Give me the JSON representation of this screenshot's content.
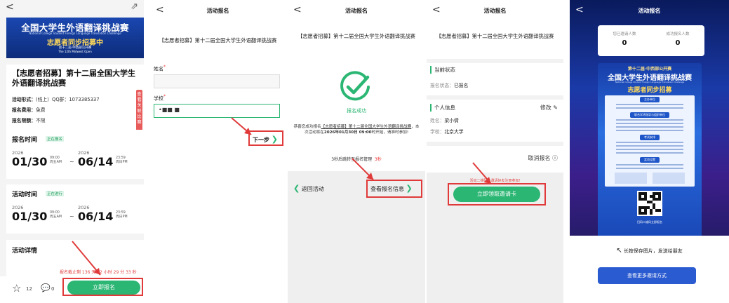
{
  "p1": {
    "back": "<",
    "share": "⇗",
    "banner": {
      "line1": "全国大学生外语翻译挑战赛",
      "line2": "National College Student Foreign Language Translation Challenge",
      "line3": "志愿者同步招募中",
      "line4": "第十二届·中西部公开赛",
      "line5": "The 12th Midwest Open"
    },
    "title": "【志愿者招募】第十二届全国大学生外语翻译挑战赛",
    "rows": [
      {
        "k": "活动形式：",
        "v": "(线上）QQ群：1073385337"
      },
      {
        "k": "报名费用：",
        "v": "免费"
      },
      {
        "k": "报名限额：",
        "v": "不限"
      }
    ],
    "side_tab": "查看关联比赛",
    "reg": {
      "label": "报名时间",
      "tag": "正在报名",
      "start_year": "2026",
      "start_date": "01/30",
      "start_time": "09:00",
      "start_day": "周五AM",
      "end_year": "2026",
      "end_date": "06/14",
      "end_time": "23:59",
      "end_day": "周日PM",
      "dash": "~"
    },
    "act": {
      "label": "活动时间",
      "tag": "正在进行",
      "start_year": "2026",
      "start_date": "01/30",
      "start_time": "09:00",
      "start_day": "周五AM",
      "end_year": "2026",
      "end_date": "06/14",
      "end_time": "23:59",
      "end_day": "周日PM",
      "dash": "~"
    },
    "detail_label": "活动详情",
    "deadline": "报名截止剩 136 天 12 小时 29 分 33 秒",
    "star_count": "12",
    "comment_count": "0",
    "register_btn": "立即报名"
  },
  "p2": {
    "back": "<",
    "header": "活动报名",
    "title": "【志愿者招募】第十二届全国大学生外语翻译挑战赛",
    "name_label": "姓名",
    "school_label": "学校",
    "school_value": "•■■ ■",
    "required": "*",
    "next": "下一步"
  },
  "p3": {
    "back": "<",
    "header": "活动报名",
    "title": "【志愿者招募】第十二届全国大学生外语翻译挑战赛",
    "success": "报名成功",
    "msg_pre": "恭喜您成功报名",
    "msg_link": "【志愿者招募】第十二届全国大学生外语翻译挑战赛",
    "msg_mid": "，本次活动将在",
    "msg_time": "2026年01月30日 09:00",
    "msg_end": "时开始，请准时参加!",
    "countdown": "3秒后跳转至报名管理",
    "countdown_sec": "3秒",
    "back_act": "返回活动",
    "view_info": "查看报名信息"
  },
  "p4": {
    "back": "<",
    "header": "活动报名",
    "title": "【志愿者招募】第十二届全国大学生外语翻译挑战赛",
    "state_label": "当前状态",
    "state_k": "报名状态：",
    "state_v": "已报名",
    "info_label": "个人信息",
    "edit": "修改",
    "name_k": "姓名：",
    "name_v": "梁小倩",
    "school_k": "学校：",
    "school_v": "北京大学",
    "cancel": "取消报名",
    "hint": "活动二维码，邀请好友注册参加!",
    "invite_btn": "立即领取邀请卡"
  },
  "p5": {
    "back": "<",
    "header": "活动报名",
    "invited_label": "您已邀请人数",
    "invited": "0",
    "success_label": "成功报名人数",
    "success": "0",
    "poster": {
      "t1": "第十二届·中西部公开赛",
      "t2": "全国大学生外语翻译挑战赛",
      "t3": "National College Student Foreign Language Translation Challenge",
      "t4": "志愿者同步招募",
      "h1": "主办单位",
      "h2": "联合学术指导与组织单位",
      "h3": "考试安排",
      "h4": "奖项设置",
      "foot": "扫码二维码立即报名"
    },
    "save_hint": "长按保存图片，发送给朋友",
    "more_btn": "查看更多邀请方式"
  },
  "colors": {
    "accent": "#2bb673",
    "alert": "#e03a3a",
    "blue": "#2b5bd0"
  }
}
